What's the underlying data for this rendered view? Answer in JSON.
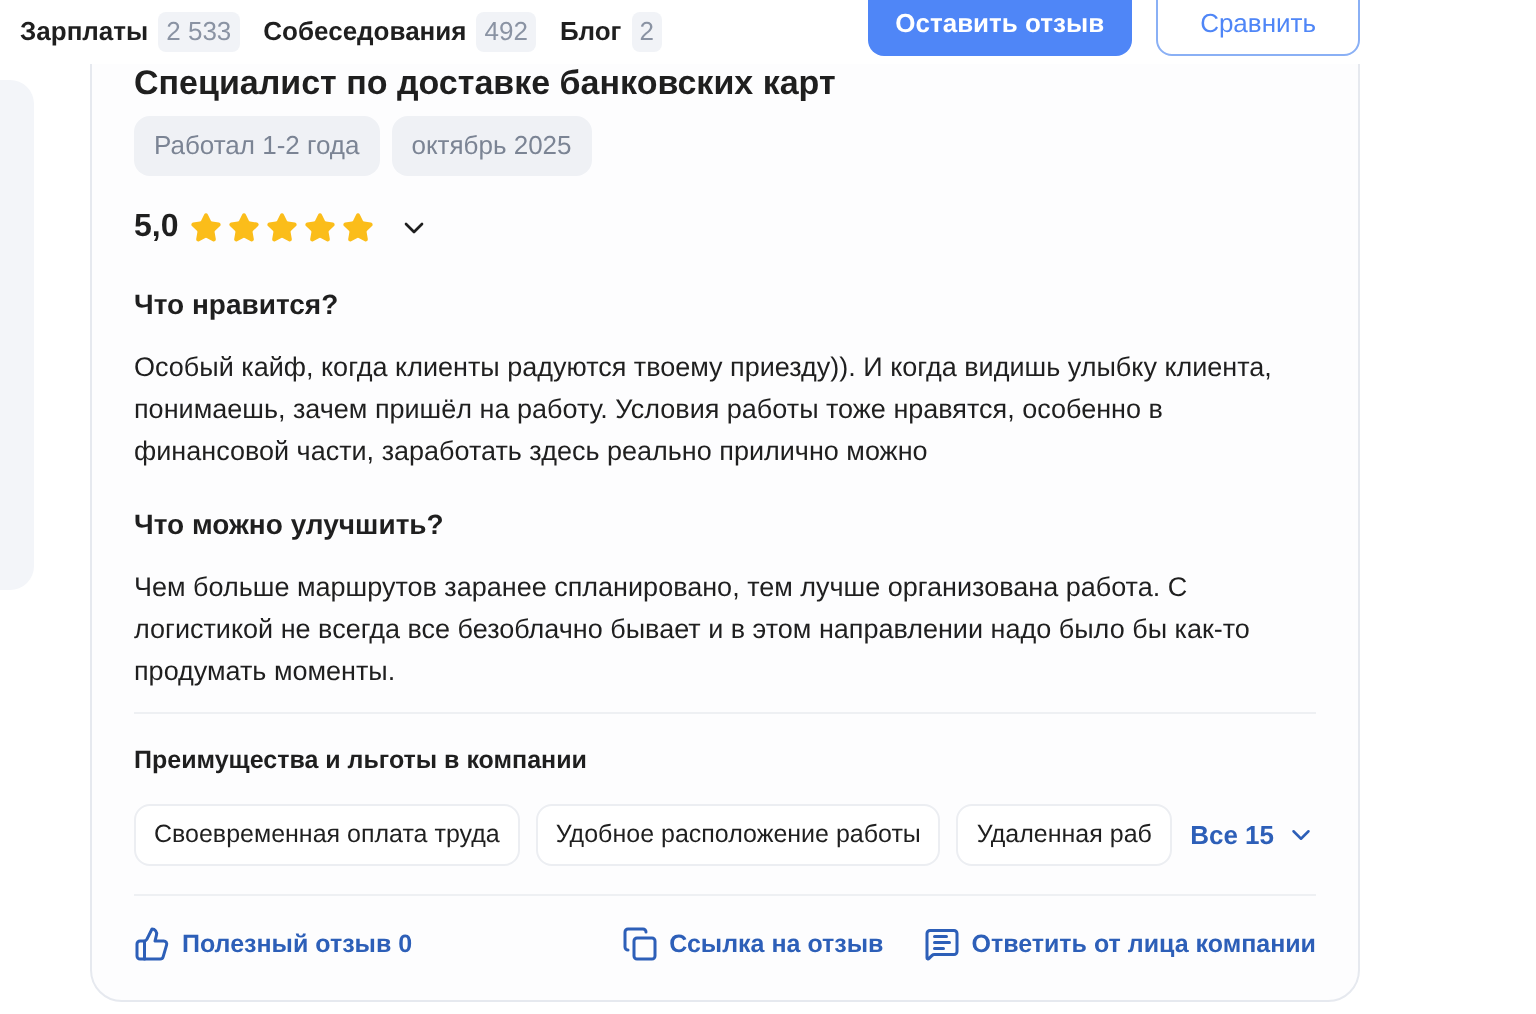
{
  "nav": [
    {
      "label": "Зарплаты",
      "count": "2 533"
    },
    {
      "label": "Собеседования",
      "count": "492"
    },
    {
      "label": "Блог",
      "count": "2"
    }
  ],
  "header_buttons": {
    "primary": "Оставить отзыв",
    "secondary": "Сравнить"
  },
  "review": {
    "position": "Специалист по доставке банковских карт",
    "tags": [
      "Работал 1-2 года",
      "октябрь 2025"
    ],
    "rating": "5,0",
    "stars": 5,
    "sections": [
      {
        "title": "Что нравится?",
        "text": "Особый кайф, когда клиенты радуются твоему приезду)). И когда видишь улыбку клиента, понимаешь, зачем пришёл на работу. Условия работы тоже нравятся, особенно в финансовой части, заработать здесь реально прилично можно"
      },
      {
        "title": "Что можно улучшить?",
        "text": "Чем больше маршрутов заранее спланировано, тем лучше организована работа. С логистикой не всегда все безоблачно бывает и в этом направлении надо было бы как-то продумать моменты."
      }
    ],
    "benefits_title": "Преимущества и льготы в компании",
    "benefits": [
      "Своевременная оплата труда",
      "Удобное расположение работы",
      "Удаленная раб"
    ],
    "benefits_more": "Все 15",
    "actions": [
      {
        "kind": "like",
        "label": "Полезный отзыв 0"
      },
      {
        "kind": "copy",
        "label": "Ссылка на отзыв"
      },
      {
        "kind": "reply",
        "label": "Ответить от лица компании"
      }
    ]
  }
}
